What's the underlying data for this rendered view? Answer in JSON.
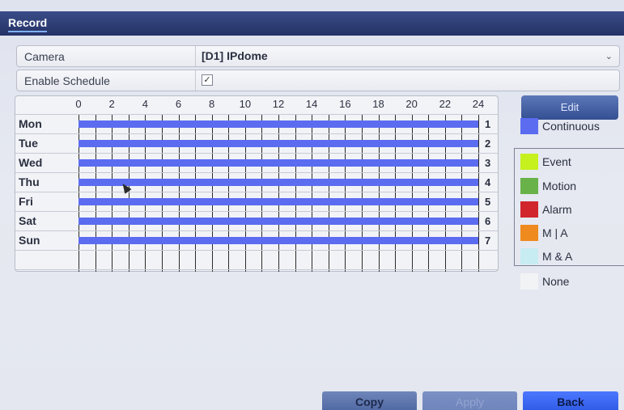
{
  "window": {
    "title": "Record"
  },
  "camera": {
    "label": "Camera",
    "value": "[D1] IPdome"
  },
  "schedule_enable": {
    "label": "Enable Schedule",
    "checked": true
  },
  "schedule": {
    "hours": [
      "0",
      "2",
      "4",
      "6",
      "8",
      "10",
      "12",
      "14",
      "16",
      "18",
      "20",
      "22",
      "24"
    ],
    "days": [
      {
        "name": "Mon",
        "num": "1",
        "mode": "Continuous"
      },
      {
        "name": "Tue",
        "num": "2",
        "mode": "Continuous"
      },
      {
        "name": "Wed",
        "num": "3",
        "mode": "Continuous"
      },
      {
        "name": "Thu",
        "num": "4",
        "mode": "Continuous"
      },
      {
        "name": "Fri",
        "num": "5",
        "mode": "Continuous"
      },
      {
        "name": "Sat",
        "num": "6",
        "mode": "Continuous"
      },
      {
        "name": "Sun",
        "num": "7",
        "mode": "Continuous"
      }
    ]
  },
  "legend": {
    "edit_label": "Edit",
    "items": [
      {
        "label": "Continuous",
        "color": "#5b6cf0"
      },
      {
        "label": "Event",
        "color": "#c6f01e"
      },
      {
        "label": "Motion",
        "color": "#69b24a"
      },
      {
        "label": "Alarm",
        "color": "#d0262c"
      },
      {
        "label": "M | A",
        "color": "#ee8a1e"
      },
      {
        "label": "M & A",
        "color": "#c7ecf2"
      },
      {
        "label": "None",
        "color": "#f2f3f5"
      }
    ]
  },
  "buttons": {
    "copy": "Copy",
    "apply": "Apply",
    "back": "Back"
  }
}
